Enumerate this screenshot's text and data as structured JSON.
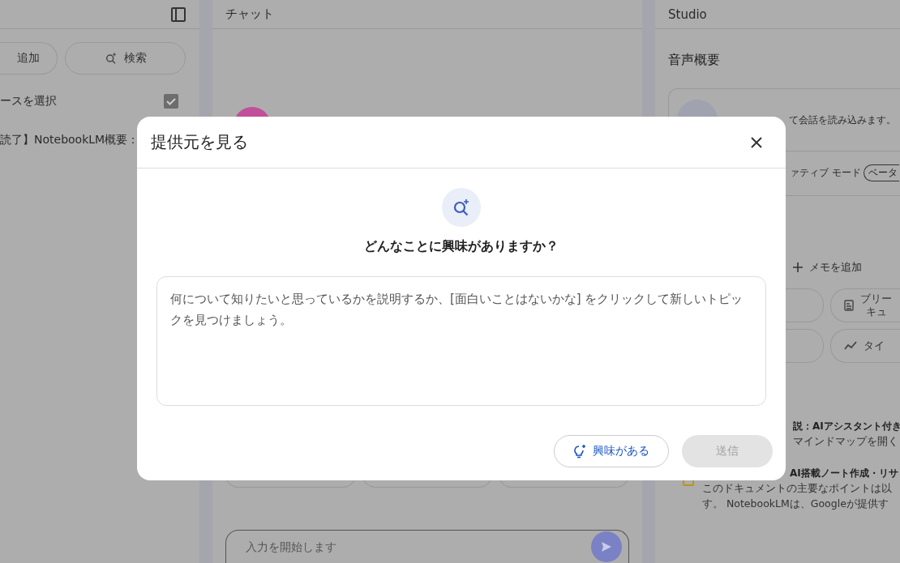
{
  "sources_panel": {
    "buttons": [
      {
        "label": "追加",
        "kind": "add"
      },
      {
        "label": "検索",
        "kind": "search"
      }
    ],
    "select_all": {
      "label": "ースを選択",
      "checked": true
    },
    "sources": [
      {
        "title": "読了】NotebookLM概要："
      }
    ]
  },
  "chat": {
    "title": "チャット",
    "input": {
      "placeholder": "入力を開始します"
    }
  },
  "studio": {
    "title": "Studio",
    "audio_overview": {
      "heading": "音声概要",
      "text": "て会話を読み込みます。",
      "mode": "ァティブ モード",
      "badge": "ベータ"
    },
    "add_note": "メモを追加",
    "tools": [
      {
        "kind": "doc",
        "lines": [
          "ブリー",
          "キュ"
        ]
      },
      {
        "kind": "trend",
        "lines": [
          "タイ"
        ]
      }
    ],
    "notes": [
      {
        "title": "説：AIアシスタント付き",
        "lines": [
          "マインドマップを開く"
        ]
      },
      {
        "title": "AI搭載ノート作成・リサ",
        "lines": [
          "このドキュメントの主要なポイントは以",
          "す。 NotebookLMは、Googleが提供す"
        ]
      }
    ]
  },
  "dialog": {
    "title": "提供元を見る",
    "question": "どんなことに興味がありますか？",
    "textarea": {
      "placeholder": "何について知りたいと思っているかを説明するか、[面白いことはないかな] をクリックして新しいトピックを見つけましょう。"
    },
    "buttons": [
      {
        "label": "興味がある",
        "kind": "outline",
        "disabled": false
      },
      {
        "label": "送信",
        "kind": "filled",
        "disabled": true
      }
    ]
  }
}
